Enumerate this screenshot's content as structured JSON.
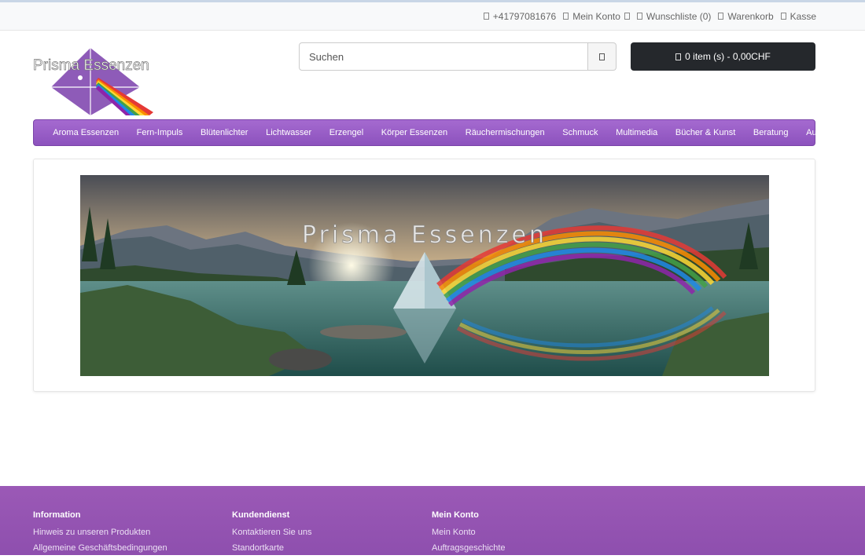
{
  "topbar": {
    "phone": "+41797081676",
    "account": "Mein Konto",
    "wishlist": "Wunschliste (0)",
    "cart": "Warenkorb",
    "checkout": "Kasse"
  },
  "logo": {
    "text": "Prisma Essenzen"
  },
  "search": {
    "placeholder": "Suchen"
  },
  "cart": {
    "label": "0 item (s) - 0,00CHF"
  },
  "nav": {
    "items": [
      "Aroma Essenzen",
      "Fern-Impuls",
      "Blütenlichter",
      "Lichtwasser",
      "Erzengel",
      "Körper Essenzen",
      "Räuchermischungen",
      "Schmuck",
      "Multimedia",
      "Bücher & Kunst",
      "Beratung",
      "Ausbildung"
    ]
  },
  "banner": {
    "title": "Prisma Essenzen"
  },
  "footer": {
    "info": {
      "title": "Information",
      "links": [
        "Hinweis zu unseren Produkten",
        "Allgemeine Geschäftsbedingungen"
      ]
    },
    "service": {
      "title": "Kundendienst",
      "links": [
        "Kontaktieren Sie uns",
        "Standortkarte"
      ]
    },
    "account": {
      "title": "Mein Konto",
      "links": [
        "Mein Konto",
        "Auftragsgeschichte"
      ]
    }
  },
  "colors": {
    "nav": "#9b5fc9",
    "footer": "#9b59b6",
    "cart_button": "#25282c"
  }
}
